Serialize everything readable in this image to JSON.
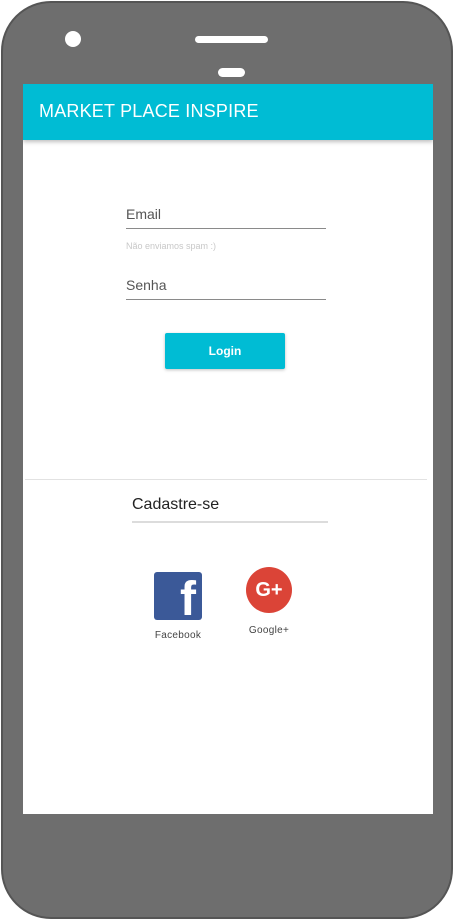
{
  "app": {
    "title": "MARKET PLACE INSPIRE"
  },
  "login": {
    "email_placeholder": "Email",
    "email_hint": "Não enviamos spam :)",
    "password_placeholder": "Senha",
    "button_label": "Login"
  },
  "signup": {
    "label": "Cadastre-se"
  },
  "social": [
    {
      "label": "Facebook",
      "icon": "facebook-icon",
      "glyph": "f",
      "color": "#3b5998"
    },
    {
      "label": "Google+",
      "icon": "google-plus-icon",
      "glyph": "G+",
      "color": "#db4437"
    }
  ],
  "colors": {
    "accent": "#00bcd4",
    "device": "#6e6e6e"
  }
}
